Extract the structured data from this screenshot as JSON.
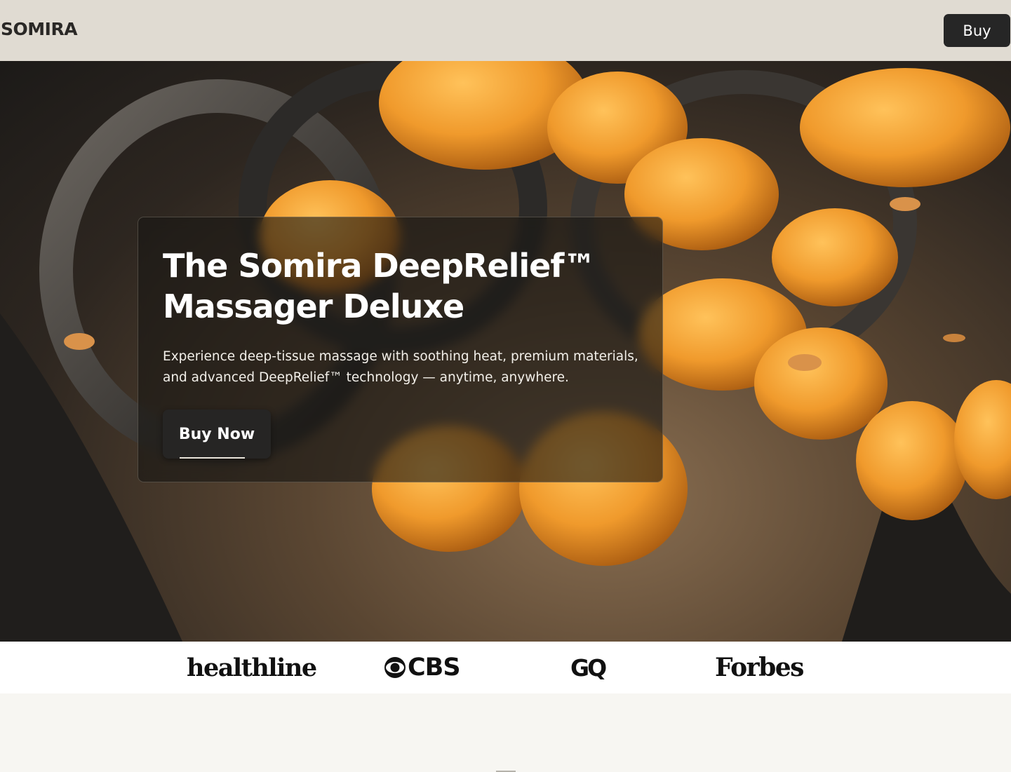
{
  "header": {
    "logo": "SOMIRA",
    "buy_label": "Buy"
  },
  "hero": {
    "title": "The Somira DeepRelief™ Massager Deluxe",
    "description": "Experience deep-tissue massage with soothing heat, premium materials, and advanced DeepRelief™ technology — anytime, anywhere.",
    "cta_label": "Buy Now"
  },
  "press": {
    "logos": [
      "healthline",
      "CBS",
      "GQ",
      "Forbes"
    ]
  },
  "colors": {
    "header_bg": "#e0dbd2",
    "button_bg": "#262626",
    "node_orange": "#f0a030",
    "page_bg": "#f7f6f2"
  }
}
